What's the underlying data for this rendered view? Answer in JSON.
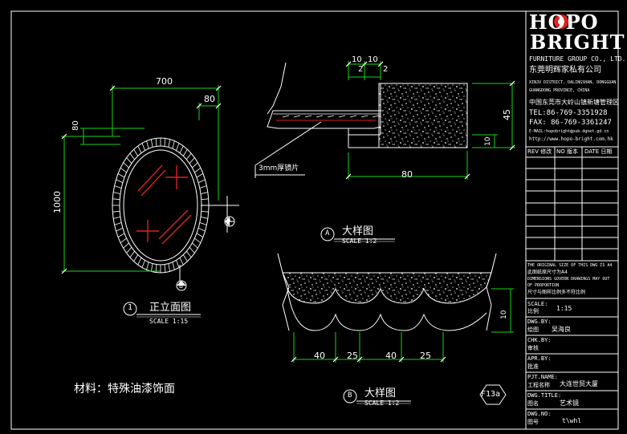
{
  "brand": {
    "logo_text": "HOPO",
    "logo_sub": "BRIGHT",
    "company_en": "FURNITURE GROUP CO., LTD.",
    "company_cn": "东莞明辉家私有公司",
    "address_en_1": "XINJU DISTRICT, DALINGSHAN, DONGGUAN",
    "address_en_2": "GUANGDONG PROVINCE, CHINA",
    "address_cn": "中国东莞市大岭山镇新塘管理区",
    "tel": "TEL:86-769-3351928",
    "fax": "FAX: 86-769-3361247",
    "email": "E-MAIL:hopobright@pub.dgnet.gd.cn",
    "web": "http://www.hopo-bright.com.hk"
  },
  "revision_header": {
    "rev": "REV 修改",
    "no": "NO 版本",
    "date": "DATE 日期"
  },
  "notes": {
    "original_size_en": "THE ORIGINAL SIZE OF THIS DWG IS A4",
    "original_size_cn": "此图纸原尺寸为A4",
    "dims_en": "DIMENSIONS GOVERN DRAWINGS MAY OUT",
    "proportion_en": "OF PROPORTION",
    "proportion_cn": "尺寸与图样比例多不符比例"
  },
  "title_block": {
    "scale_label": "SCALE:",
    "scale_label_cn": "比例",
    "scale_value": "1:15",
    "dwg_by_label": "DWG.BY:",
    "dwg_by_cn": "绘图",
    "dwg_by_value": "吴海良",
    "chk_by_label": "CHK.BY:",
    "chk_by_cn": "审核",
    "apr_by_label": "APR.BY:",
    "apr_by_cn": "批准",
    "pjt_name_label": "PJT.NAME:",
    "pjt_name_cn": "工程名称",
    "pjt_name_value": "大连世贸大厦",
    "dwg_title_label": "DWG.TITLE:",
    "dwg_title_cn": "图名",
    "dwg_title_value": "艺术镜",
    "dwg_no_label": "DWG.NO:",
    "dwg_no_cn": "图号",
    "dwg_no_value": "t\\whl"
  },
  "elevation": {
    "title": "正立面图",
    "number": "1",
    "scale": "SCALE 1:15",
    "dim_width": "700",
    "dim_frame_top": "80",
    "dim_frame_side": "80",
    "dim_height": "1000",
    "marker_a": "A",
    "marker_b": "B"
  },
  "detail_a": {
    "title": "大样图",
    "marker": "A",
    "scale": "SCALE 1:2",
    "dim_10a": "10",
    "dim_10b": "10",
    "dim_2a": "2",
    "dim_2b": "2",
    "dim_45": "45",
    "dim_10c": "10",
    "dim_80": "80",
    "callout": "3mm厚镜片"
  },
  "detail_b": {
    "title": "大样图",
    "marker": "B",
    "scale": "SCALE 1:2",
    "dims": [
      "40",
      "25",
      "40",
      "25"
    ],
    "dim_side": "10"
  },
  "material_note": "材料：特殊油漆饰面",
  "sheet_tag": "F13a"
}
